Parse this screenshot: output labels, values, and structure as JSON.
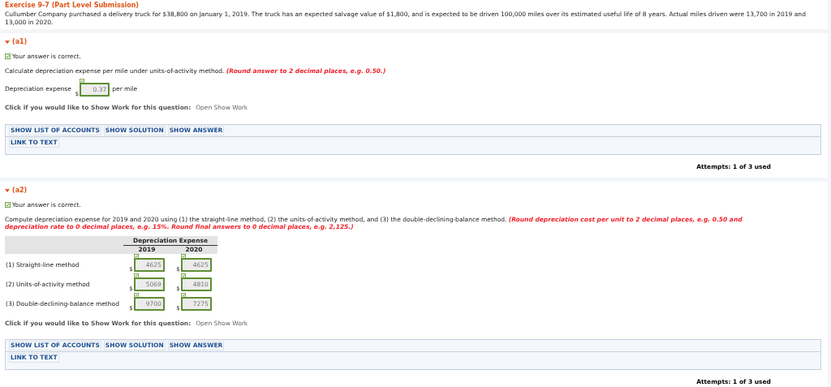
{
  "exercise": {
    "title": "Exercise 9-7 (Part Level Submission)",
    "text": "Cullumber Company purchased a delivery truck for $38,800 on January 1, 2019. The truck has an expected salvage value of $1,800, and is expected to be driven 100,000 miles over its estimated useful life of 8 years. Actual miles driven were 13,700 in 2019 and 13,000 in 2020."
  },
  "parts": [
    {
      "kind": "single",
      "label": "(a1)",
      "expanded": true,
      "correct": true,
      "feedback": "Your answer is correct.",
      "instruction": "Calculate depreciation expense per mile under units-of-activity method.",
      "note": "(Round answer to 2 decimal places, e.g. 0.50.)",
      "field": {
        "label": "Depreciation expense",
        "currency": "$",
        "value": "0.37",
        "correct": true,
        "unit": "per mile"
      },
      "show_work": {
        "prompt": "Click if you would like to Show Work for this question:",
        "link": "Open Show Work"
      },
      "buttons": [
        [
          "SHOW LIST OF ACCOUNTS",
          "SHOW SOLUTION",
          "SHOW ANSWER"
        ],
        [
          "LINK TO TEXT"
        ]
      ],
      "attempts": "Attempts: 1 of 3 used"
    },
    {
      "kind": "table",
      "label": "(a2)",
      "expanded": true,
      "correct": true,
      "feedback": "Your answer is correct.",
      "instruction": "Compute depreciation expense for 2019 and 2020 using (1) the straight-line method, (2) the units-of-activity method, and (3) the double-declining-balance method.",
      "note": "(Round depreciation cost per unit to 2 decimal places, e.g. 0.50 and depreciation rate to 0 decimal places, e.g. 15%. Round final answers to 0 decimal places, e.g. 2,125.)",
      "table": {
        "group_header": "Depreciation Expense",
        "columns": [
          "2019",
          "2020"
        ],
        "rows": [
          {
            "label": "(1) Straight-line method",
            "cells": [
              {
                "currency": "$",
                "value": "4625",
                "correct": true
              },
              {
                "currency": "$",
                "value": "4625",
                "correct": true
              }
            ]
          },
          {
            "label": "(2) Units-of-activity method",
            "cells": [
              {
                "currency": "$",
                "value": "5069",
                "correct": true
              },
              {
                "currency": "$",
                "value": "4810",
                "correct": true
              }
            ]
          },
          {
            "label": "(3) Double-declining-balance method",
            "cells": [
              {
                "currency": "$",
                "value": "9700",
                "correct": true
              },
              {
                "currency": "$",
                "value": "7275",
                "correct": true
              }
            ]
          }
        ]
      },
      "show_work": {
        "prompt": "Click if you would like to Show Work for this question:",
        "link": "Open Show Work"
      },
      "buttons": [
        [
          "SHOW LIST OF ACCOUNTS",
          "SHOW SOLUTION",
          "SHOW ANSWER"
        ],
        [
          "LINK TO TEXT"
        ]
      ],
      "attempts": "Attempts: 1 of 3 used"
    }
  ]
}
